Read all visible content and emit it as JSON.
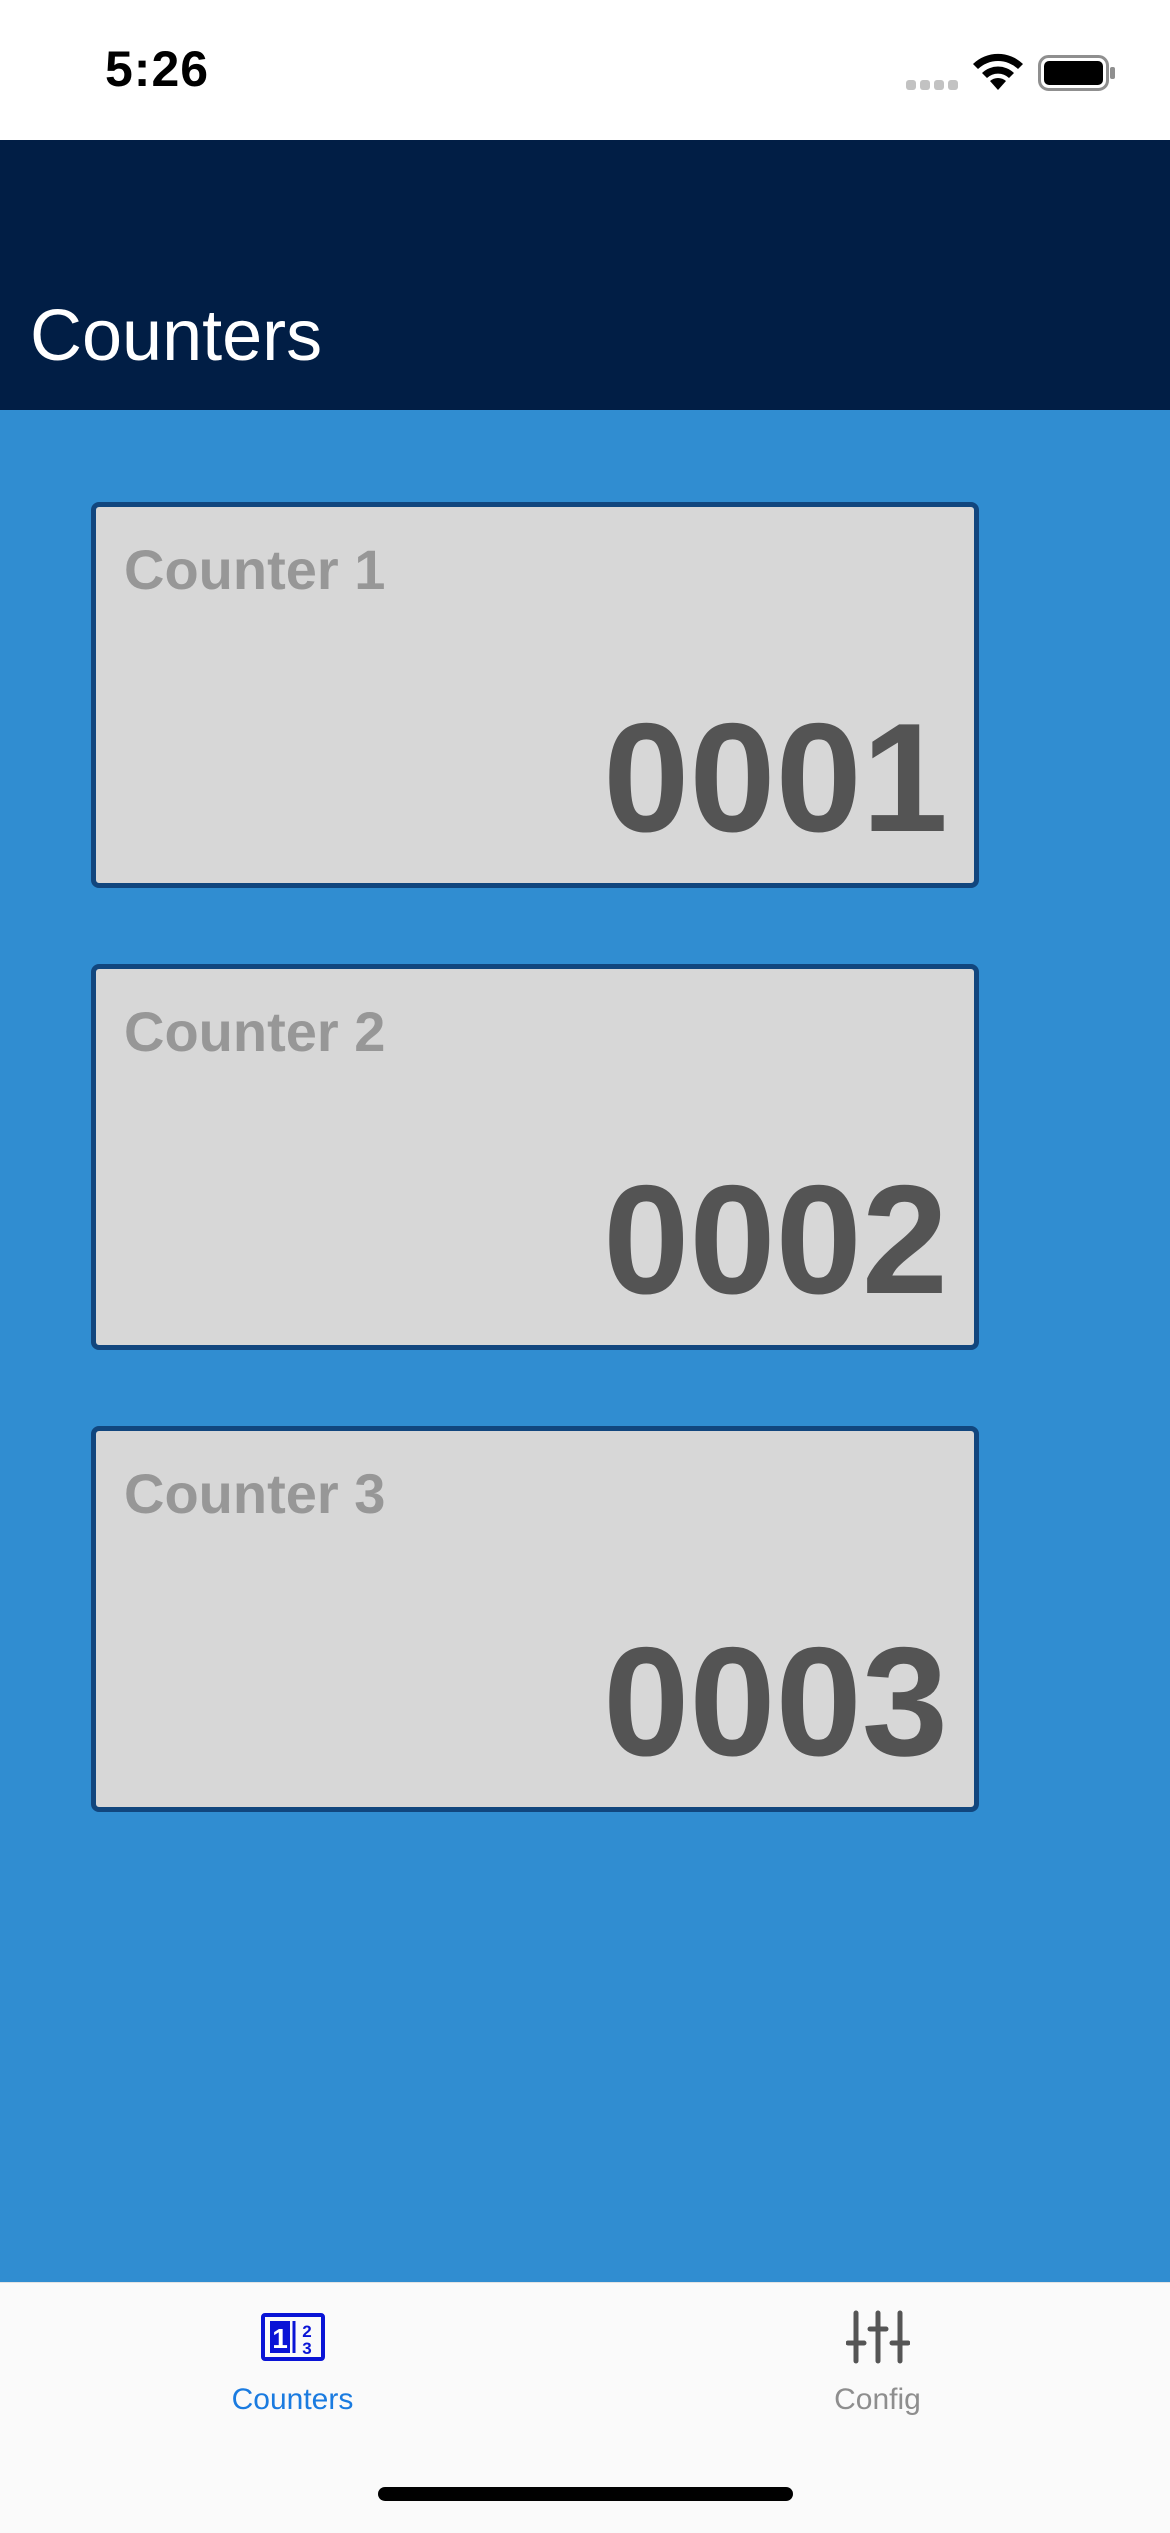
{
  "status_bar": {
    "time": "5:26"
  },
  "header": {
    "title": "Counters",
    "background_color": "#011e45"
  },
  "content": {
    "background_color": "#308dd1",
    "counters": [
      {
        "label": "Counter 1",
        "value": "0001"
      },
      {
        "label": "Counter 2",
        "value": "0002"
      },
      {
        "label": "Counter 3",
        "value": "0003"
      }
    ]
  },
  "tab_bar": {
    "tabs": [
      {
        "label": "Counters",
        "icon": "counter-digits-icon",
        "selected": true,
        "color": "#1a7be0"
      },
      {
        "label": "Config",
        "icon": "sliders-icon",
        "selected": false,
        "color": "#8e8e8e"
      }
    ]
  }
}
